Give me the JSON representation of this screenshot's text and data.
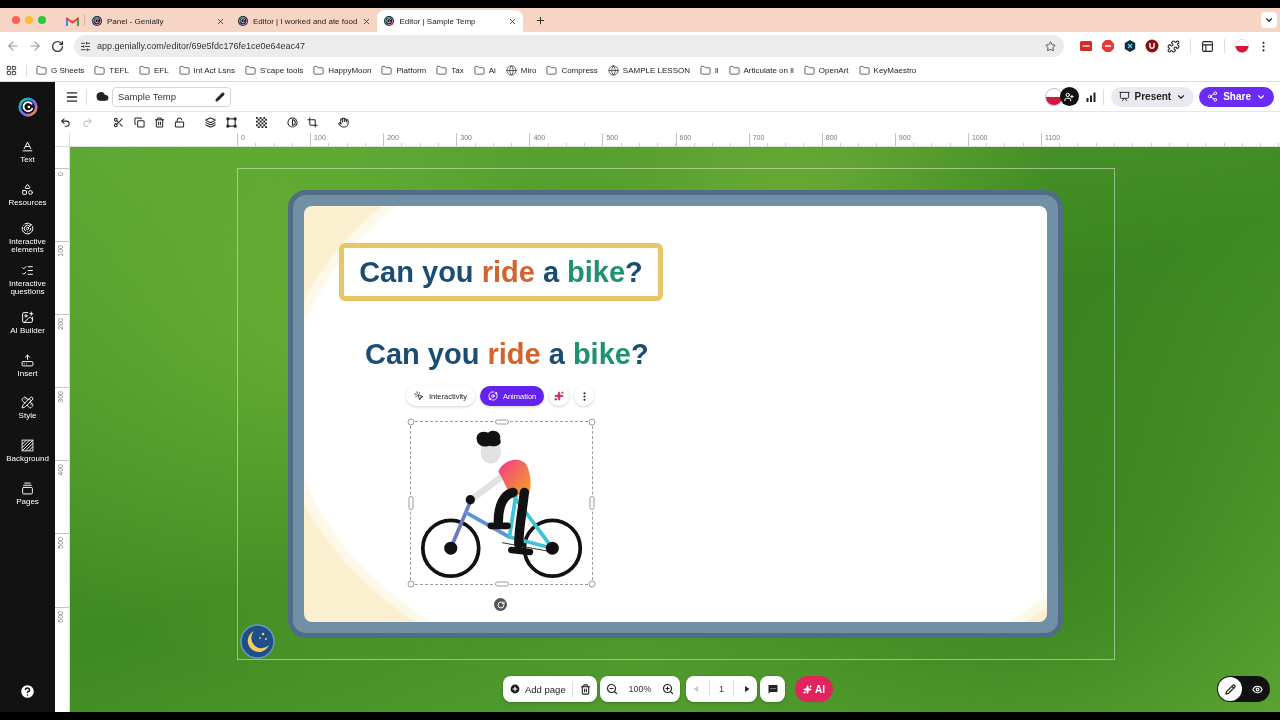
{
  "browser": {
    "tabs": [
      {
        "title": "Panel - Genially",
        "selected": false
      },
      {
        "title": "Editor | I worked and ate food",
        "selected": false
      },
      {
        "title": "Editor | Sample Temp",
        "selected": true
      }
    ],
    "url": "app.genially.com/editor/69e5fdc176fe1ce0e64eac47",
    "bookmarks": [
      {
        "label": "G Sheets",
        "kind": "folder"
      },
      {
        "label": "TEFL",
        "kind": "folder"
      },
      {
        "label": "EFL",
        "kind": "folder"
      },
      {
        "label": "Int Act Lsns",
        "kind": "folder"
      },
      {
        "label": "S'cape tools",
        "kind": "folder"
      },
      {
        "label": "HappyMoon",
        "kind": "folder"
      },
      {
        "label": "Platform",
        "kind": "folder"
      },
      {
        "label": "Tax",
        "kind": "folder"
      },
      {
        "label": "Ai",
        "kind": "folder"
      },
      {
        "label": "Miro",
        "kind": "site"
      },
      {
        "label": "Compress",
        "kind": "folder"
      },
      {
        "label": "SAMPLE LESSON",
        "kind": "site"
      },
      {
        "label": "ll",
        "kind": "folder"
      },
      {
        "label": "Articulate on ll",
        "kind": "folder"
      },
      {
        "label": "OpenArt",
        "kind": "folder"
      },
      {
        "label": "KeyMaestro",
        "kind": "folder"
      }
    ]
  },
  "header": {
    "title": "Sample Temp",
    "present": "Present",
    "share": "Share"
  },
  "sidebar": {
    "items": [
      {
        "label": "Text",
        "kind": "text"
      },
      {
        "label": "Resources",
        "kind": "resources"
      },
      {
        "label": "Interactive elements",
        "kind": "interactive"
      },
      {
        "label": "Interactive questions",
        "kind": "questions"
      },
      {
        "label": "AI Builder",
        "kind": "ai"
      },
      {
        "label": "Insert",
        "kind": "insert"
      },
      {
        "label": "Style",
        "kind": "style"
      },
      {
        "label": "Background",
        "kind": "background"
      },
      {
        "label": "Pages",
        "kind": "pages"
      }
    ]
  },
  "toolbar": {
    "redo_disabled": true
  },
  "rulers": {
    "horizontal": [
      "0",
      "100",
      "200",
      "300",
      "400",
      "500",
      "600",
      "700",
      "800",
      "900",
      "1000",
      "1100"
    ],
    "vertical": [
      "0",
      "100",
      "200",
      "300",
      "400",
      "500",
      "600"
    ]
  },
  "slide": {
    "title_box": [
      {
        "text": "Can you ",
        "color": "#1b4d72"
      },
      {
        "text": "ride",
        "color": "#d4622c"
      },
      {
        "text": " a ",
        "color": "#1b4d72"
      },
      {
        "text": "bike",
        "color": "#1e9170"
      },
      {
        "text": "?",
        "color": "#1b4d72"
      }
    ],
    "heading": [
      {
        "text": "Can you ",
        "color": "#1b4d72"
      },
      {
        "text": "ride",
        "color": "#d4622c"
      },
      {
        "text": " a ",
        "color": "#1b4d72"
      },
      {
        "text": "bike",
        "color": "#1e9170"
      },
      {
        "text": "?",
        "color": "#1b4d72"
      }
    ],
    "element_toolbar": [
      {
        "label": "Interactivity",
        "kind": "interactivity",
        "selected": false
      },
      {
        "label": "Animation",
        "kind": "animation",
        "selected": true
      }
    ]
  },
  "bottom_bar": {
    "add_page": "Add page",
    "zoom": "100%",
    "page": "1",
    "prev_disabled": true,
    "ai": "AI"
  },
  "view_modes": [
    {
      "kind": "edit",
      "selected": true
    },
    {
      "kind": "preview",
      "selected": false
    }
  ]
}
